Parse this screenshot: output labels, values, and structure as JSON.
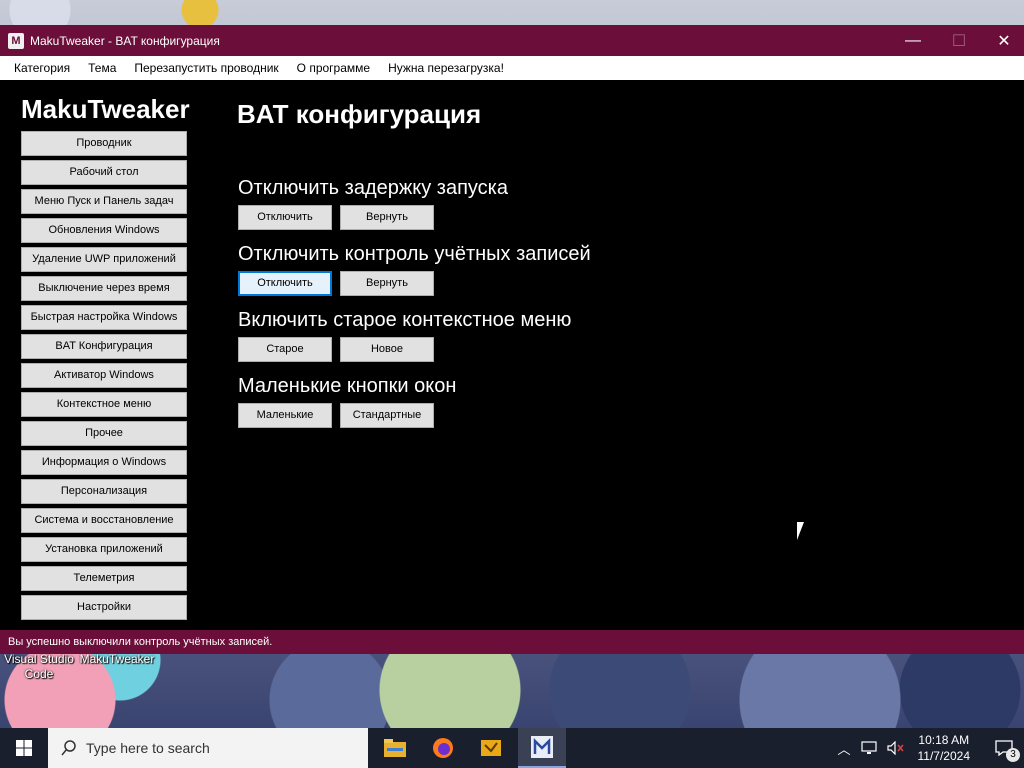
{
  "window": {
    "title": "MakuTweaker - BAT конфигурация",
    "app_icon_glyph": "M",
    "controls": {
      "minimize": "—",
      "maximize": "☐",
      "close": "✕"
    }
  },
  "menubar": {
    "items": [
      "Категория",
      "Тема",
      "Перезапустить проводник",
      "О программе",
      "Нужна перезагрузка!"
    ]
  },
  "sidebar": {
    "brand": "MakuTweaker",
    "items": [
      "Проводник",
      "Рабочий стол",
      "Меню Пуск и Панель задач",
      "Обновления Windows",
      "Удаление UWP приложений",
      "Выключение через время",
      "Быстрая настройка Windows",
      "BAT Конфигурация",
      "Активатор Windows",
      "Контекстное меню",
      "Прочее",
      "Информация о Windows",
      "Персонализация",
      "Система и восстановление",
      "Установка приложений",
      "Телеметрия",
      "Настройки"
    ]
  },
  "main": {
    "title": "BAT конфигурация",
    "sections": [
      {
        "title": "Отключить задержку запуска",
        "buttons": [
          "Отключить",
          "Вернуть"
        ]
      },
      {
        "title": "Отключить контроль учётных записей",
        "buttons": [
          "Отключить",
          "Вернуть"
        ]
      },
      {
        "title": "Включить старое контекстное меню",
        "buttons": [
          "Старое",
          "Новое"
        ]
      },
      {
        "title": "Маленькие кнопки окон",
        "buttons": [
          "Маленькие",
          "Стандартные"
        ]
      }
    ]
  },
  "statusbar": {
    "text": "Вы успешно выключили контроль учётных записей."
  },
  "desktop": {
    "icons": [
      {
        "label_line1": "Visual Studio",
        "label_line2": "Code"
      },
      {
        "label_line1": "MakuTweaker",
        "label_line2": ""
      }
    ]
  },
  "taskbar": {
    "search_placeholder": "Type here to search",
    "apps": [
      "file-explorer-icon",
      "firefox-icon",
      "app-icon-yellow",
      "makutweaker-icon"
    ],
    "clock_time": "10:18 AM",
    "clock_date": "11/7/2024",
    "notification_count": "3"
  },
  "colors": {
    "accent": "#6b0f3a",
    "focus": "#0078d7"
  }
}
